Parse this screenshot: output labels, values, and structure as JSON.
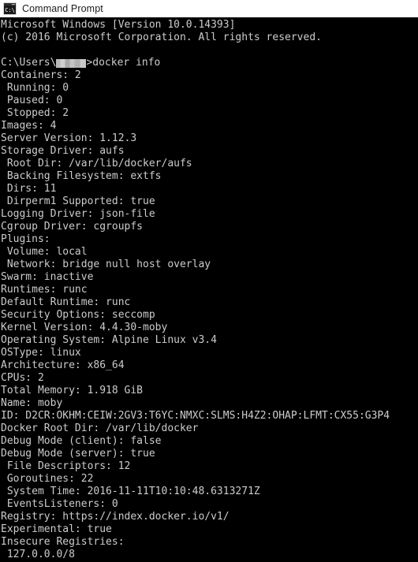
{
  "window": {
    "title": "Command Prompt",
    "icon": "command-prompt-icon",
    "background_color": "#000000",
    "titlebar_color": "#ffffff",
    "text_color": "#cccccc"
  },
  "console": {
    "header": [
      "Microsoft Windows [Version 10.0.14393]",
      "(c) 2016 Microsoft Corporation. All rights reserved."
    ],
    "prompt": {
      "prefix": "C:\\Users\\",
      "redacted_username": "",
      "suffix": ">",
      "command": "docker info"
    },
    "output": [
      "Containers: 2",
      " Running: 0",
      " Paused: 0",
      " Stopped: 2",
      "Images: 4",
      "Server Version: 1.12.3",
      "Storage Driver: aufs",
      " Root Dir: /var/lib/docker/aufs",
      " Backing Filesystem: extfs",
      " Dirs: 11",
      " Dirperm1 Supported: true",
      "Logging Driver: json-file",
      "Cgroup Driver: cgroupfs",
      "Plugins:",
      " Volume: local",
      " Network: bridge null host overlay",
      "Swarm: inactive",
      "Runtimes: runc",
      "Default Runtime: runc",
      "Security Options: seccomp",
      "Kernel Version: 4.4.30-moby",
      "Operating System: Alpine Linux v3.4",
      "OSType: linux",
      "Architecture: x86_64",
      "CPUs: 2",
      "Total Memory: 1.918 GiB",
      "Name: moby",
      "ID: D2CR:OKHM:CEIW:2GV3:T6YC:NMXC:SLMS:H4Z2:OHAP:LFMT:CX55:G3P4",
      "Docker Root Dir: /var/lib/docker",
      "Debug Mode (client): false",
      "Debug Mode (server): true",
      " File Descriptors: 12",
      " Goroutines: 22",
      " System Time: 2016-11-11T10:10:48.6313271Z",
      " EventsListeners: 0",
      "Registry: https://index.docker.io/v1/",
      "Experimental: true",
      "Insecure Registries:",
      " 127.0.0.0/8"
    ]
  }
}
